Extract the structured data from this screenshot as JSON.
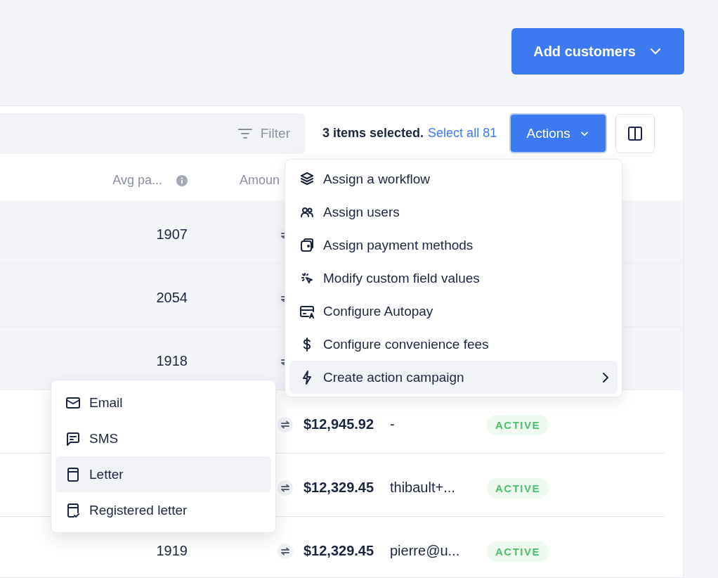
{
  "add_button": {
    "label": "Add customers"
  },
  "toolbar": {
    "filter": "Filter",
    "selection_text": "3 items selected.",
    "select_all_link": "Select all 81",
    "actions_button": "Actions"
  },
  "table": {
    "columns": [
      {
        "label": "Avg pa...",
        "info": true
      },
      {
        "label": "Amoun"
      }
    ],
    "rows": [
      {
        "selected": true,
        "avg": "1907"
      },
      {
        "selected": true,
        "avg": "2054"
      },
      {
        "selected": true,
        "avg": "1918"
      },
      {
        "selected": false,
        "amount": "$12,945.92",
        "email": "-",
        "status": "ACTIVE"
      },
      {
        "selected": false,
        "amount": "$12,329.45",
        "email": "thibault+...",
        "status": "ACTIVE"
      },
      {
        "selected": false,
        "avg": "1919",
        "amount": "$12,329.45",
        "email": "pierre@u...",
        "status": "ACTIVE"
      }
    ]
  },
  "actions_menu": {
    "items": [
      {
        "kind": "layers",
        "label": "Assign a workflow",
        "selected": false,
        "submenu": false
      },
      {
        "kind": "users",
        "label": "Assign users",
        "selected": false,
        "submenu": false
      },
      {
        "kind": "wallet",
        "label": "Assign payment methods",
        "selected": false,
        "submenu": false
      },
      {
        "kind": "cursor",
        "label": "Modify custom field values",
        "selected": false,
        "submenu": false
      },
      {
        "kind": "card",
        "label": "Configure Autopay",
        "selected": false,
        "submenu": false
      },
      {
        "kind": "dollar",
        "label": "Configure convenience fees",
        "selected": false,
        "submenu": false
      },
      {
        "kind": "bolt",
        "label": "Create action campaign",
        "selected": true,
        "submenu": true
      }
    ]
  },
  "submenu": {
    "items": [
      {
        "kind": "mail",
        "label": "Email",
        "selected": false
      },
      {
        "kind": "chat",
        "label": "SMS",
        "selected": false
      },
      {
        "kind": "letter",
        "label": "Letter",
        "selected": true
      },
      {
        "kind": "registered",
        "label": "Registered letter",
        "selected": false
      }
    ]
  }
}
